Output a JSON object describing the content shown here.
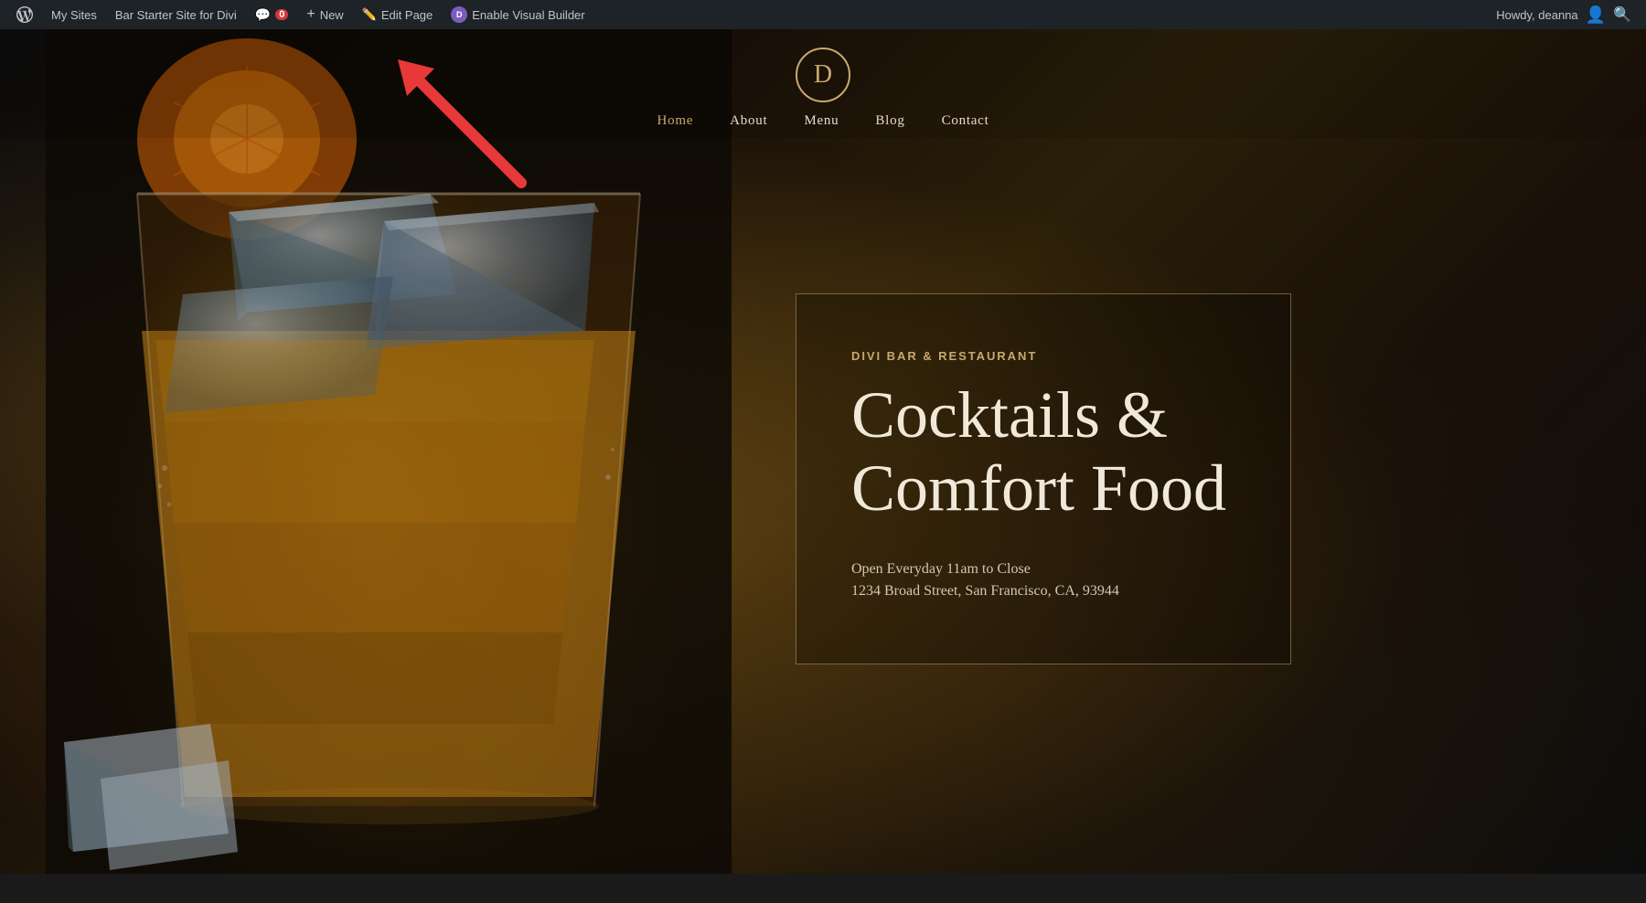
{
  "adminBar": {
    "mySites": "My Sites",
    "siteName": "Bar Starter Site for Divi",
    "comments": "0",
    "new": "New",
    "editPage": "Edit Page",
    "enableVisualBuilder": "Enable Visual Builder",
    "howdy": "Howdy, deanna",
    "searchAriaLabel": "Search"
  },
  "site": {
    "logo": "D",
    "nav": {
      "home": "Home",
      "about": "About",
      "menu": "Menu",
      "blog": "Blog",
      "contact": "Contact"
    }
  },
  "hero": {
    "eyebrow": "DIVI BAR & RESTAURANT",
    "titleLine1": "Cocktails &",
    "titleLine2": "Comfort Food",
    "hours": "Open Everyday 11am to Close",
    "address": "1234 Broad Street, San Francisco, CA, 93944"
  },
  "colors": {
    "gold": "#c8a96e",
    "adminBg": "#1d2327",
    "heroBg": "#1a1a1a",
    "textLight": "#f0e8d8",
    "textMuted": "#d0c8b8"
  },
  "arrow": {
    "color": "#e8383a"
  }
}
